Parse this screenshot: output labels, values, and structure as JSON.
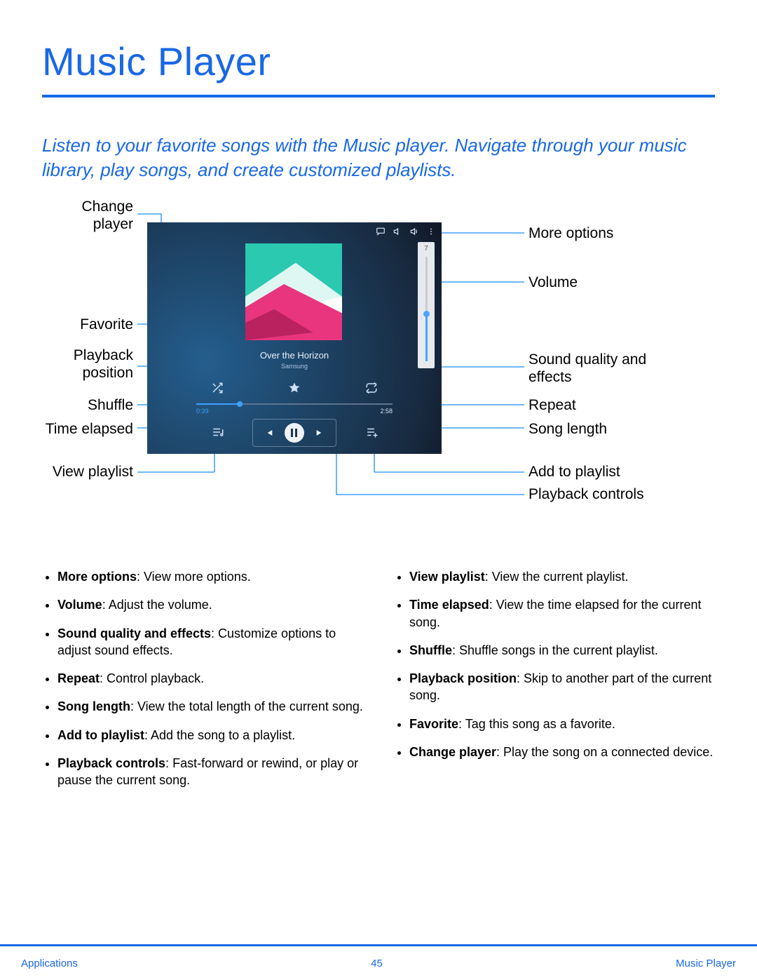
{
  "title": "Music Player",
  "intro": "Listen to your favorite songs with the Music player. Navigate through your music library, play songs, and create customized playlists.",
  "player": {
    "song_title": "Over the Horizon",
    "artist": "Samsung",
    "time_elapsed": "0:39",
    "song_length": "2:58",
    "volume_value": "7"
  },
  "labels": {
    "left": {
      "change_player": "Change player",
      "favorite": "Favorite",
      "playback_position": "Playback position",
      "shuffle": "Shuffle",
      "time_elapsed": "Time elapsed",
      "view_playlist": "View playlist"
    },
    "right": {
      "more_options": "More options",
      "volume": "Volume",
      "sound_quality": "Sound quality and effects",
      "repeat": "Repeat",
      "song_length": "Song length",
      "add_to_playlist": "Add to playlist",
      "playback_controls": "Playback controls"
    }
  },
  "bullets": {
    "left": [
      {
        "term": "More options",
        "desc": ": View more options."
      },
      {
        "term": "Volume",
        "desc": ": Adjust the volume."
      },
      {
        "term": "Sound quality and effects",
        "desc": ": Customize options to adjust sound effects."
      },
      {
        "term": "Repeat",
        "desc": ": Control playback."
      },
      {
        "term": "Song length",
        "desc": ": View the total length of the current song."
      },
      {
        "term": "Add to playlist",
        "desc": ": Add the song to a playlist."
      },
      {
        "term": "Playback controls",
        "desc": ": Fast-forward or rewind, or play or pause the current song."
      }
    ],
    "right": [
      {
        "term": "View playlist",
        "desc": ": View the current playlist."
      },
      {
        "term": "Time elapsed",
        "desc": ": View the time elapsed for the current song."
      },
      {
        "term": "Shuffle",
        "desc": ": Shuffle songs in the current playlist."
      },
      {
        "term": "Playback position",
        "desc": ": Skip to another part of the current song."
      },
      {
        "term": "Favorite",
        "desc": ": Tag this song as a favorite."
      },
      {
        "term": "Change player",
        "desc": ": Play the song on a connected device."
      }
    ]
  },
  "footer": {
    "left": "Applications",
    "center": "45",
    "right": "Music Player"
  }
}
